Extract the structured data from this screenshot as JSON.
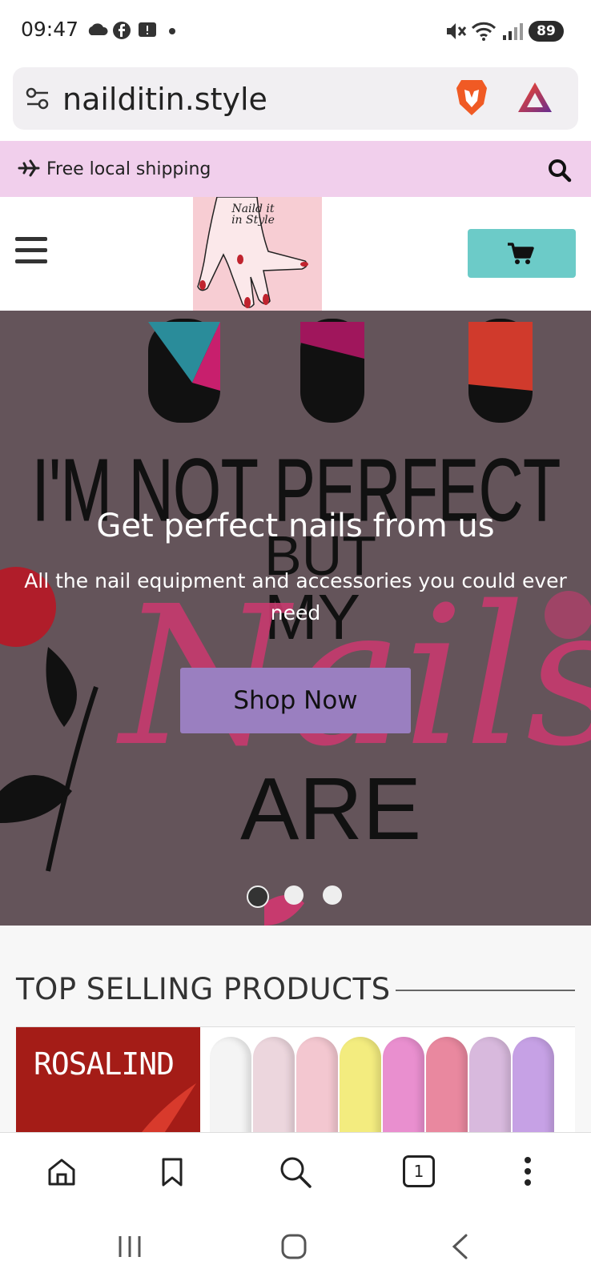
{
  "status_bar": {
    "time": "09:47",
    "battery": "89"
  },
  "browser": {
    "url": "nailditin.style"
  },
  "promo": {
    "text": "Free local shipping"
  },
  "logo": {
    "text": "Naild it in Style"
  },
  "hero": {
    "headline": "Get perfect nails from us",
    "subtext": "All the nail equipment and accessories you could ever need",
    "button_label": "Shop Now",
    "background_words": [
      "I'M NOT PERFECT",
      "BUT",
      "MY",
      "Nails",
      "ARE"
    ],
    "slides": 3,
    "active_slide": 1
  },
  "section": {
    "title": "TOP SELLING PRODUCTS"
  },
  "product": {
    "brand": "ROSALIND",
    "swatches": [
      "#f4f4f4",
      "#ecd6dd",
      "#f3c7d0",
      "#f3ec7f",
      "#e98fcf",
      "#e9889f",
      "#d8b9dd",
      "#c6a1e5"
    ]
  },
  "toolbar": {
    "tabs_count": "1"
  },
  "colors": {
    "promo": "#f1cfec",
    "cart": "#6ccbc8",
    "shop_button": "#9a7fc0",
    "hero_bg": "#64545a"
  }
}
